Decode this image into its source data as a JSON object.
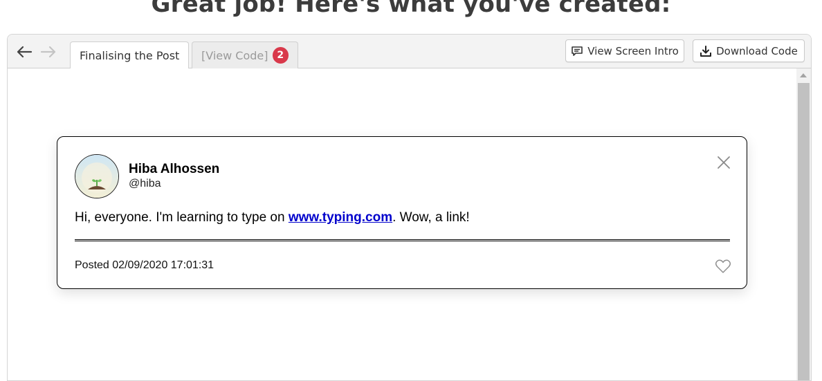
{
  "heading": "Great job! Here's what you've created:",
  "toolbar": {
    "tabs": [
      {
        "label": "Finalising the Post",
        "active": true
      },
      {
        "label": "[View Code]",
        "active": false,
        "badge": "2"
      }
    ],
    "view_intro_label": "View Screen Intro",
    "download_label": "Download Code",
    "icons": {
      "back": "arrow-left-icon",
      "forward": "arrow-right-icon",
      "intro": "chat-bubble-icon",
      "download": "download-icon"
    }
  },
  "post": {
    "name": "Hiba Alhossen",
    "handle": "@hiba",
    "text_before": "Hi, everyone. I'm learning to type on ",
    "link_text": "www.typing.com",
    "text_after": ". Wow, a link!",
    "posted": "Posted 02/09/2020 17:01:31",
    "icons": {
      "avatar": "seedling-avatar",
      "close": "close-icon",
      "like": "heart-icon"
    }
  },
  "colors": {
    "badge": "#d9394b",
    "link": "#0000cc",
    "heading": "#3c3c3c",
    "toolbar_bg": "#f3f3f3"
  }
}
